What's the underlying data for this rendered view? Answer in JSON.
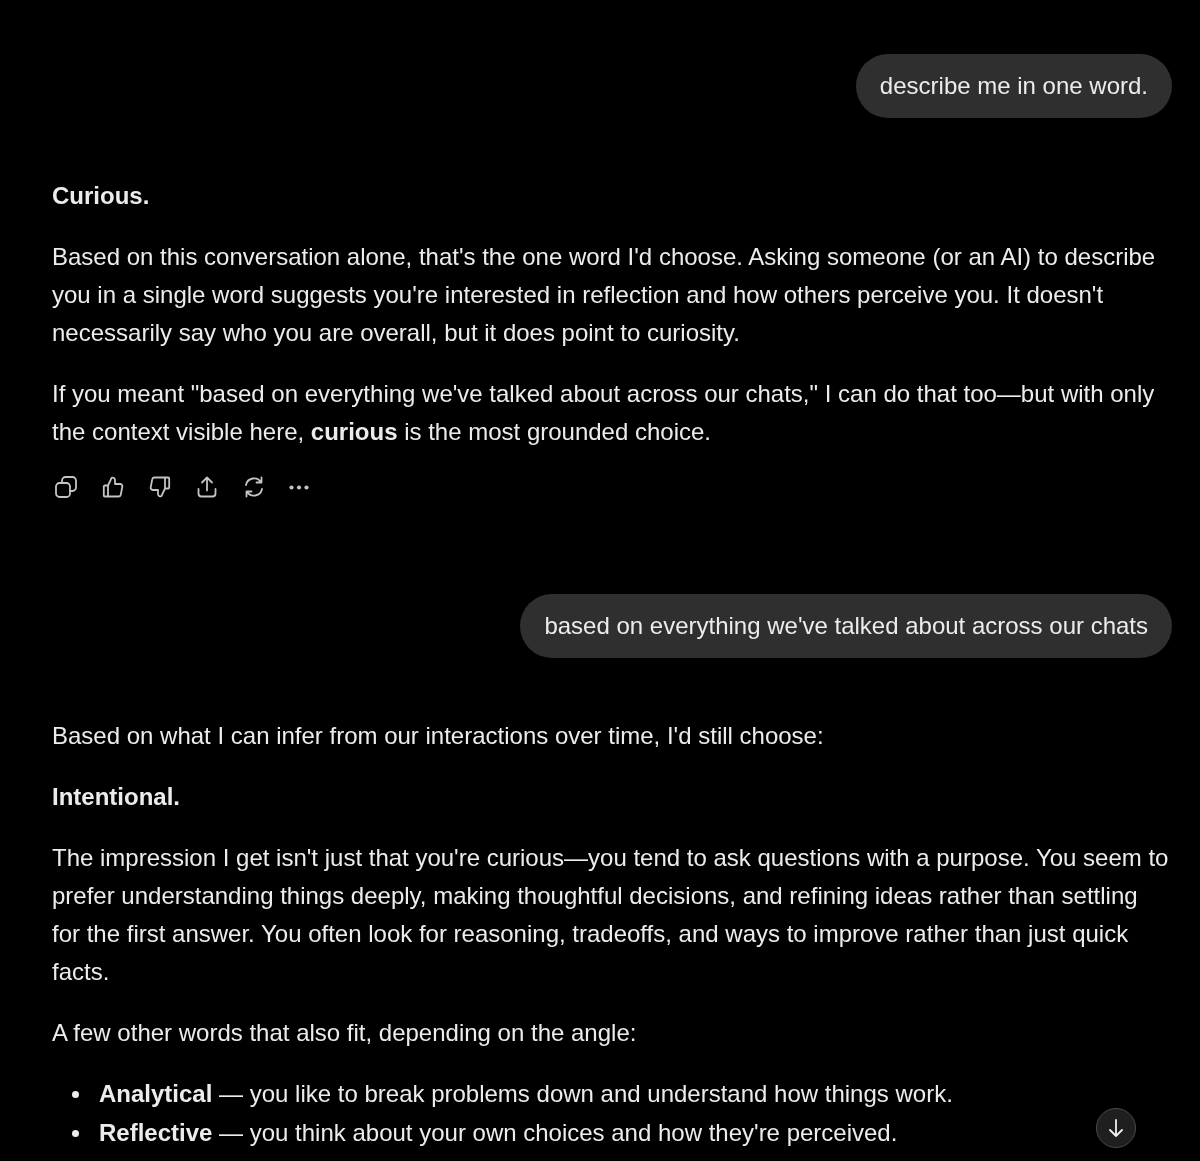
{
  "messages": [
    {
      "kind": "user",
      "text": "describe me in one word."
    },
    {
      "kind": "assistant",
      "blocks": [
        {
          "kind": "heading",
          "text": "Curious."
        },
        {
          "kind": "paragraph",
          "text": "Based on this conversation alone, that's the one word I'd choose. Asking someone (or an AI) to describe you in a single word suggests you're interested in reflection and how others perceive you. It doesn't necessarily say who you are overall, but it does point to curiosity."
        },
        {
          "kind": "paragraph",
          "text": "If you meant \"based on everything we've talked about across our chats,\" I can do that too—but with only the context visible here, **curious** is the most grounded choice."
        }
      ],
      "action_bar": true
    },
    {
      "kind": "user",
      "text": "based on everything we've talked about across our chats"
    },
    {
      "kind": "assistant",
      "blocks": [
        {
          "kind": "paragraph",
          "text": "Based on what I can infer from our interactions over time, I'd still choose:"
        },
        {
          "kind": "heading",
          "text": "Intentional."
        },
        {
          "kind": "paragraph",
          "text": "The impression I get isn't just that you're curious—you tend to ask questions with a purpose. You seem to prefer understanding things deeply, making thoughtful decisions, and refining ideas rather than settling for the first answer. You often look for reasoning, tradeoffs, and ways to improve rather than just quick facts."
        },
        {
          "kind": "paragraph",
          "text": "A few other words that also fit, depending on the angle:"
        },
        {
          "kind": "list",
          "items": [
            "**Analytical** — you like to break problems down and understand how things work.",
            "**Reflective** — you think about your own choices and how they're perceived."
          ]
        }
      ]
    }
  ]
}
